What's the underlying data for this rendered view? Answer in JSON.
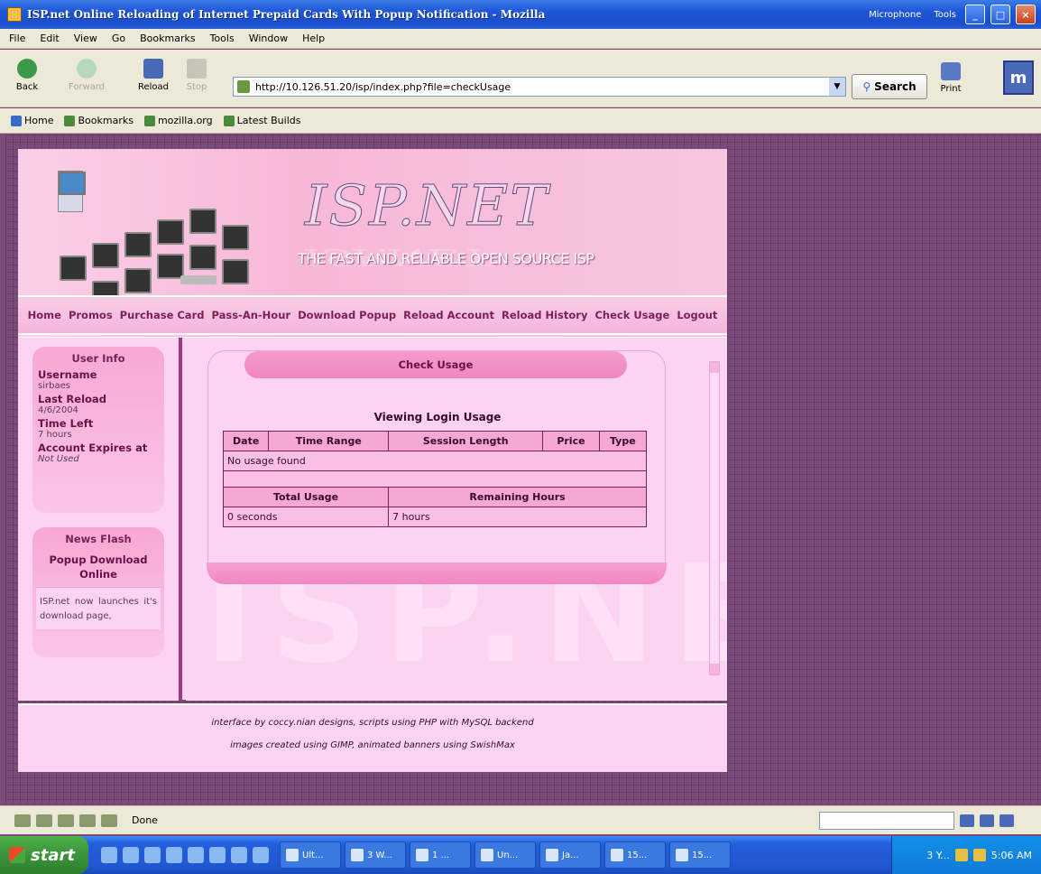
{
  "window": {
    "title": "ISP.net Online Reloading of Internet Prepaid Cards With Popup Notification - Mozilla",
    "right_items": [
      "Microphone",
      "Tools"
    ]
  },
  "menu": [
    "File",
    "Edit",
    "View",
    "Go",
    "Bookmarks",
    "Tools",
    "Window",
    "Help"
  ],
  "nav": {
    "back": "Back",
    "forward": "Forward",
    "reload": "Reload",
    "stop": "Stop",
    "url": "http://10.126.51.20/isp/index.php?file=checkUsage",
    "search": "Search",
    "print": "Print"
  },
  "personal_toolbar": [
    "Home",
    "Bookmarks",
    "mozilla.org",
    "Latest Builds"
  ],
  "banner": {
    "brand": "ISP.NET",
    "tagline": "THE FAST AND RELIABLE OPEN SOURCE ISP"
  },
  "topnav": [
    "Home",
    "Promos",
    "Purchase Card",
    "Pass-An-Hour",
    "Download Popup",
    "Reload Account",
    "Reload History",
    "Check Usage",
    "Logout"
  ],
  "user_info": {
    "title": "User Info",
    "username_label": "Username",
    "username": "sirbaes",
    "last_reload_label": "Last Reload",
    "last_reload": "4/6/2004",
    "time_left_label": "Time Left",
    "time_left": "7 hours",
    "expires_label": "Account Expires at",
    "expires": "Not Used"
  },
  "news": {
    "title": "News Flash",
    "headline": "Popup Download Online",
    "body": "ISP.net now launches it's download page,"
  },
  "usage": {
    "title": "Check Usage",
    "subtitle": "Viewing Login Usage",
    "columns": [
      "Date",
      "Time Range",
      "Session Length",
      "Price",
      "Type"
    ],
    "empty_message": "No usage found",
    "summary_columns": [
      "Total Usage",
      "Remaining Hours"
    ],
    "total_usage": "0 seconds",
    "remaining_hours": "7 hours"
  },
  "watermark": "ISP.NET",
  "footer": {
    "line1": "interface by coccy.nian designs, scripts using PHP with MySQL backend",
    "line2": "images created using GIMP, animated banners using SwishMax"
  },
  "status": "Done",
  "taskbar": {
    "start": "start",
    "tasks": [
      "Ult...",
      "3 W...",
      "1 ...",
      "Un...",
      "Ja...",
      "15...",
      "15...",
      "3 Y..."
    ],
    "clock": "5:06 AM"
  }
}
